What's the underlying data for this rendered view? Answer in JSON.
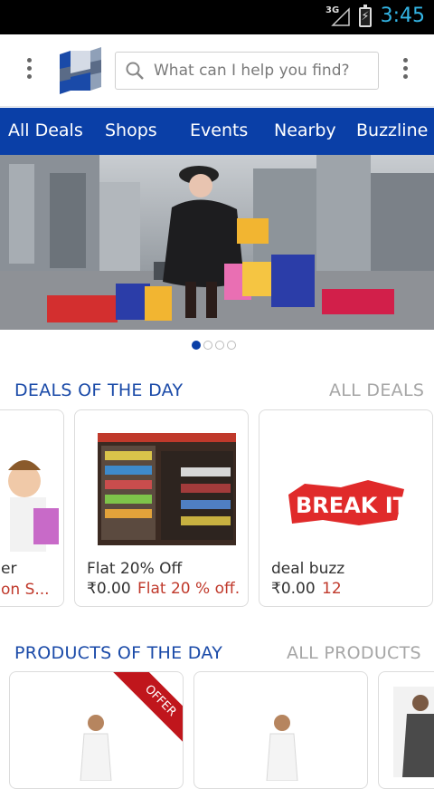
{
  "status_bar": {
    "network": "3G",
    "time": "3:45"
  },
  "header": {
    "search_placeholder": "What can I help you find?"
  },
  "nav": {
    "tabs": [
      "All Deals",
      "Shops",
      "Events",
      "Nearby",
      "Buzzline"
    ]
  },
  "carousel": {
    "page_count": 4,
    "active_page": 1
  },
  "deals_section": {
    "title": "DEALS OF THE DAY",
    "link": "ALL DEALS",
    "cards": [
      {
        "title": "er",
        "subtitle": "on S..."
      },
      {
        "title": "Flat 20% Off",
        "price": "₹0.00",
        "subtitle": "Flat 20 % off."
      },
      {
        "title": "deal buzz",
        "price": "₹0.00",
        "subtitle": "12",
        "image_text": "BREAK IT"
      }
    ]
  },
  "products_section": {
    "title": "PRODUCTS OF THE DAY",
    "link": "ALL PRODUCTS",
    "offer_badge": "OFFER"
  },
  "colors": {
    "brand_blue": "#0a3fa7",
    "accent_red": "#c0392b",
    "status_blue": "#33b5e5"
  }
}
